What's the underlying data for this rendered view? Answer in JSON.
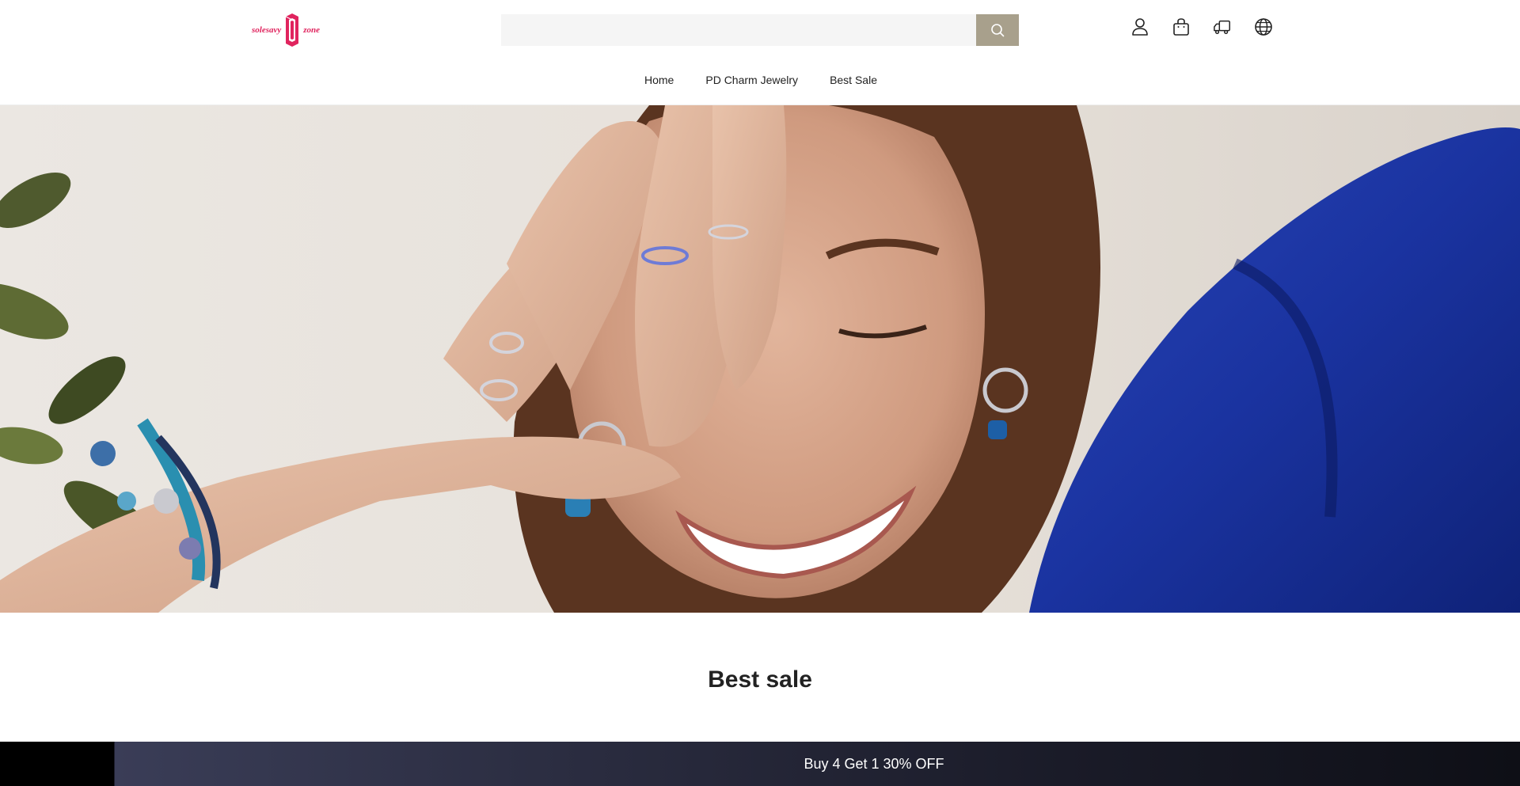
{
  "header": {
    "logo": {
      "text_left": "solesavy",
      "text_right": "zone",
      "brand_color": "#e0245e"
    },
    "search": {
      "value": "",
      "placeholder": "",
      "button_icon": "search-icon",
      "button_color": "#a8a08c"
    },
    "icons": [
      "user-icon",
      "bag-icon",
      "truck-icon",
      "globe-icon"
    ]
  },
  "nav": {
    "items": [
      {
        "label": "Home"
      },
      {
        "label": "PD Charm Jewelry"
      },
      {
        "label": "Best Sale"
      }
    ]
  },
  "hero": {
    "image": "hero-banner-woman-jewelry"
  },
  "section": {
    "title": "Best sale"
  },
  "promo": {
    "text": "Buy 4 Get 1 30% OFF"
  }
}
